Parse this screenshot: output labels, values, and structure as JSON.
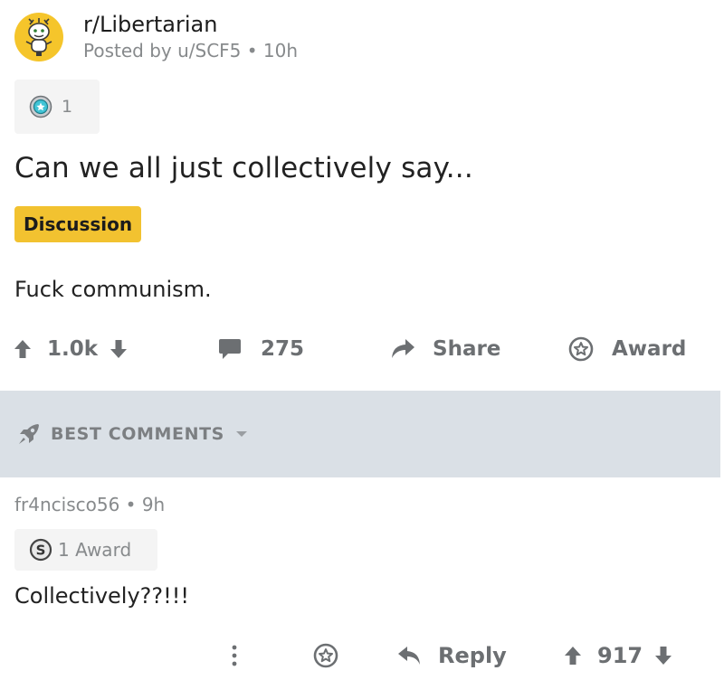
{
  "post": {
    "subreddit": "r/Libertarian",
    "posted_by": "Posted by u/SCF5 • 10h",
    "award_count": "1",
    "title": "Can we all just collectively say...",
    "flair": "Discussion",
    "body": "Fuck communism."
  },
  "post_actions": {
    "upvotes": "1.0k",
    "comments": "275",
    "share_label": "Share",
    "award_label": "Award"
  },
  "sort_bar": {
    "label": "BEST COMMENTS"
  },
  "comment": {
    "meta": "fr4ncisco56 • 9h",
    "award_label": "1 Award",
    "text": "Collectively??!!!",
    "reply_label": "Reply",
    "score": "917"
  },
  "colors": {
    "avatar_bg": "#f5c52b",
    "flair_bg": "#f2c230",
    "sort_bar_bg": "#dae0e6",
    "muted_text": "#878a8c",
    "action_icon": "#6c6f72"
  },
  "icons": {
    "avatar": "snoo-avatar-icon",
    "post_award": "award-medal-icon",
    "upvote": "upvote-arrow-icon",
    "downvote": "downvote-arrow-icon",
    "comments": "comment-bubble-icon",
    "share": "share-arrow-icon",
    "award": "award-outline-icon",
    "sort": "rocket-icon",
    "dropdown": "caret-down-icon",
    "comment_award": "silver-coin-icon",
    "more": "more-vertical-icon",
    "reply": "reply-arrow-icon"
  }
}
